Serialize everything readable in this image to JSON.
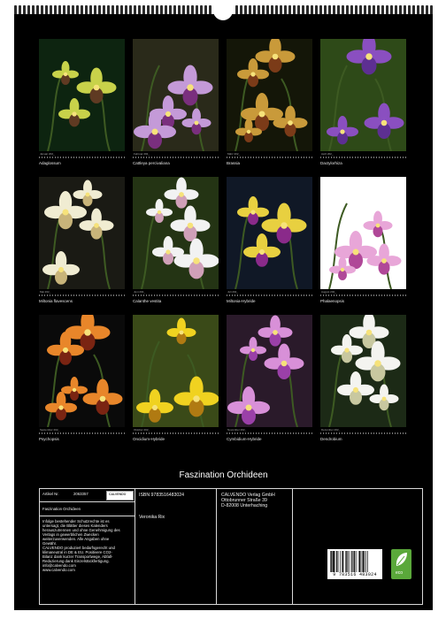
{
  "calendar": {
    "title": "Faszination Orchideen",
    "months": [
      {
        "month": "Januar 202_",
        "caption": "Adaglossum",
        "palette": [
          "#0d2410",
          "#c8d24a",
          "#5f3a22"
        ]
      },
      {
        "month": "Februar 202_",
        "caption": "Cattleya percivaliana",
        "palette": [
          "#2a2a1a",
          "#c49ad8",
          "#7a2f7e"
        ]
      },
      {
        "month": "März 202_",
        "caption": "Brassia",
        "palette": [
          "#141608",
          "#c99a3a",
          "#7b3b18"
        ]
      },
      {
        "month": "April 202_",
        "caption": "Dactylorhiza",
        "palette": [
          "#2e4a18",
          "#8a4fc0",
          "#5d2f92"
        ]
      },
      {
        "month": "Mai 202_",
        "caption": "Miltonia flavescens",
        "palette": [
          "#1a1a14",
          "#f0ecd2",
          "#c8b47a"
        ]
      },
      {
        "month": "Juni 202_",
        "caption": "Calanthe vestita",
        "palette": [
          "#243414",
          "#f2f2f2",
          "#d0a0b8"
        ]
      },
      {
        "month": "Juli 202_",
        "caption": "Miltonia-Hybride",
        "palette": [
          "#101826",
          "#e8d040",
          "#8a2a8a"
        ]
      },
      {
        "month": "August 202_",
        "caption": "Phalaenopsis",
        "palette": [
          "#ffffff",
          "#e8a6d8",
          "#b04898"
        ]
      },
      {
        "month": "September 202_",
        "caption": "Psychopsis",
        "palette": [
          "#0a0a0a",
          "#e8862a",
          "#7a2412"
        ]
      },
      {
        "month": "Oktober 202_",
        "caption": "Oncidium-Hybride",
        "palette": [
          "#3a4a18",
          "#f0d220",
          "#b07a12"
        ]
      },
      {
        "month": "November 202_",
        "caption": "Cymbidium-Hybride",
        "palette": [
          "#2a1a2a",
          "#d890d8",
          "#9a40a8"
        ]
      },
      {
        "month": "Dezember 202_",
        "caption": "Dendrobium",
        "palette": [
          "#1c2a16",
          "#f4f4f0",
          "#c8c8a0"
        ]
      }
    ]
  },
  "info": {
    "article_label": "Artikel Nr.",
    "article_number": "2063357",
    "series_title": "Faszination Orchideen",
    "isbn": "ISBN 9783516483024",
    "author": "Veronika Rix",
    "publisher_lines": [
      "CALVENDO Verlag GmbH",
      "Ottobrunner Straße 39",
      "D-82008 Unterhaching"
    ],
    "logo_text": "CALVENDO",
    "legal_lines": [
      "Infolge bestehender Schutzrechte ist es",
      "untersagt, die Blätter dieses Kalenders",
      "herauszutrennen und ohne Genehmigung des",
      "Verlags in gewerblichen Zwecken",
      "weiterzuverwenden. Alle Angaben ohne",
      "Gewähr.",
      "CALVENDO produziert bedarfsgerecht und",
      "klimaneutral in DE & EU. Positivere CO2-",
      "Bilanz dank kurzer Transportwege, Abfall-",
      "Reduzierung dank Einzelstückfertigung.",
      "info@calvendo.com",
      "www.calvendo.com"
    ],
    "barcode_number": "9 783516 483024",
    "eco_label": "eco"
  }
}
